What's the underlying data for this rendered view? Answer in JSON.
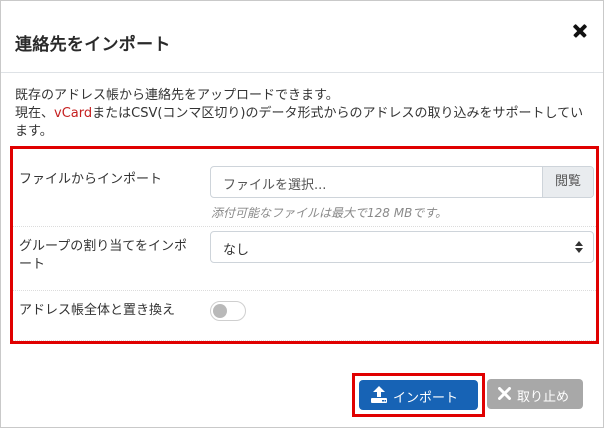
{
  "dialog": {
    "title": "連絡先をインポート",
    "close_icon": "close-icon"
  },
  "intro": {
    "line1": "既存のアドレス帳から連絡先をアップロードできます。",
    "line2_prefix": "現在、",
    "line2_vcard": "vCard",
    "line2_suffix": "またはCSV(コンマ区切り)のデータ形式からのアドレスの取り込みをサポートしています。",
    "vcard_color": "#c51f1f"
  },
  "form": {
    "file": {
      "label": "ファイルからインポート",
      "value": "ファイルを選択...",
      "browse_label": "閲覧",
      "hint": "添付可能なファイルは最大で128 MBです。"
    },
    "group": {
      "label": "グループの割り当てをインポート",
      "selected": "なし"
    },
    "replace": {
      "label": "アドレス帳全体と置き換え",
      "enabled": false
    }
  },
  "buttons": {
    "import": {
      "label": "インポート",
      "icon": "upload-icon",
      "color": "#1763b5"
    },
    "cancel": {
      "label": "取り止め",
      "icon": "close-icon",
      "color": "#a8a8a8"
    }
  },
  "highlight_color": "#e00000"
}
